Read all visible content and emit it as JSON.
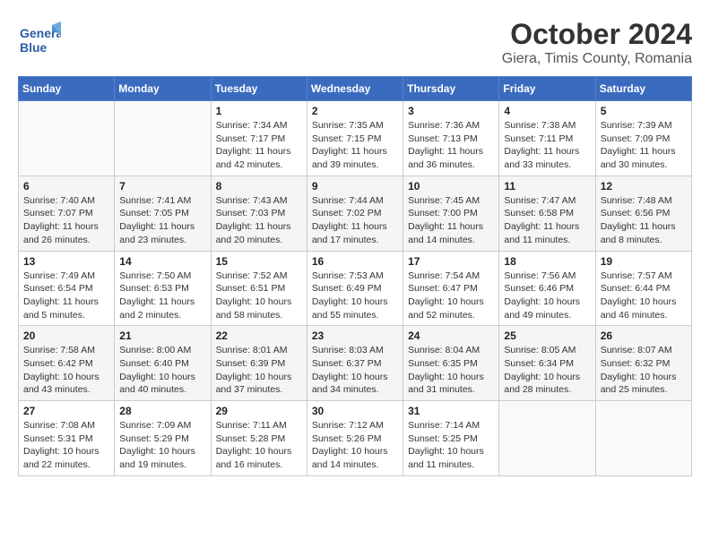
{
  "header": {
    "logo_line1": "General",
    "logo_line2": "Blue",
    "title": "October 2024",
    "subtitle": "Giera, Timis County, Romania"
  },
  "weekdays": [
    "Sunday",
    "Monday",
    "Tuesday",
    "Wednesday",
    "Thursday",
    "Friday",
    "Saturday"
  ],
  "weeks": [
    [
      {
        "day": "",
        "sunrise": "",
        "sunset": "",
        "daylight": ""
      },
      {
        "day": "",
        "sunrise": "",
        "sunset": "",
        "daylight": ""
      },
      {
        "day": "1",
        "sunrise": "Sunrise: 7:34 AM",
        "sunset": "Sunset: 7:17 PM",
        "daylight": "Daylight: 11 hours and 42 minutes."
      },
      {
        "day": "2",
        "sunrise": "Sunrise: 7:35 AM",
        "sunset": "Sunset: 7:15 PM",
        "daylight": "Daylight: 11 hours and 39 minutes."
      },
      {
        "day": "3",
        "sunrise": "Sunrise: 7:36 AM",
        "sunset": "Sunset: 7:13 PM",
        "daylight": "Daylight: 11 hours and 36 minutes."
      },
      {
        "day": "4",
        "sunrise": "Sunrise: 7:38 AM",
        "sunset": "Sunset: 7:11 PM",
        "daylight": "Daylight: 11 hours and 33 minutes."
      },
      {
        "day": "5",
        "sunrise": "Sunrise: 7:39 AM",
        "sunset": "Sunset: 7:09 PM",
        "daylight": "Daylight: 11 hours and 30 minutes."
      }
    ],
    [
      {
        "day": "6",
        "sunrise": "Sunrise: 7:40 AM",
        "sunset": "Sunset: 7:07 PM",
        "daylight": "Daylight: 11 hours and 26 minutes."
      },
      {
        "day": "7",
        "sunrise": "Sunrise: 7:41 AM",
        "sunset": "Sunset: 7:05 PM",
        "daylight": "Daylight: 11 hours and 23 minutes."
      },
      {
        "day": "8",
        "sunrise": "Sunrise: 7:43 AM",
        "sunset": "Sunset: 7:03 PM",
        "daylight": "Daylight: 11 hours and 20 minutes."
      },
      {
        "day": "9",
        "sunrise": "Sunrise: 7:44 AM",
        "sunset": "Sunset: 7:02 PM",
        "daylight": "Daylight: 11 hours and 17 minutes."
      },
      {
        "day": "10",
        "sunrise": "Sunrise: 7:45 AM",
        "sunset": "Sunset: 7:00 PM",
        "daylight": "Daylight: 11 hours and 14 minutes."
      },
      {
        "day": "11",
        "sunrise": "Sunrise: 7:47 AM",
        "sunset": "Sunset: 6:58 PM",
        "daylight": "Daylight: 11 hours and 11 minutes."
      },
      {
        "day": "12",
        "sunrise": "Sunrise: 7:48 AM",
        "sunset": "Sunset: 6:56 PM",
        "daylight": "Daylight: 11 hours and 8 minutes."
      }
    ],
    [
      {
        "day": "13",
        "sunrise": "Sunrise: 7:49 AM",
        "sunset": "Sunset: 6:54 PM",
        "daylight": "Daylight: 11 hours and 5 minutes."
      },
      {
        "day": "14",
        "sunrise": "Sunrise: 7:50 AM",
        "sunset": "Sunset: 6:53 PM",
        "daylight": "Daylight: 11 hours and 2 minutes."
      },
      {
        "day": "15",
        "sunrise": "Sunrise: 7:52 AM",
        "sunset": "Sunset: 6:51 PM",
        "daylight": "Daylight: 10 hours and 58 minutes."
      },
      {
        "day": "16",
        "sunrise": "Sunrise: 7:53 AM",
        "sunset": "Sunset: 6:49 PM",
        "daylight": "Daylight: 10 hours and 55 minutes."
      },
      {
        "day": "17",
        "sunrise": "Sunrise: 7:54 AM",
        "sunset": "Sunset: 6:47 PM",
        "daylight": "Daylight: 10 hours and 52 minutes."
      },
      {
        "day": "18",
        "sunrise": "Sunrise: 7:56 AM",
        "sunset": "Sunset: 6:46 PM",
        "daylight": "Daylight: 10 hours and 49 minutes."
      },
      {
        "day": "19",
        "sunrise": "Sunrise: 7:57 AM",
        "sunset": "Sunset: 6:44 PM",
        "daylight": "Daylight: 10 hours and 46 minutes."
      }
    ],
    [
      {
        "day": "20",
        "sunrise": "Sunrise: 7:58 AM",
        "sunset": "Sunset: 6:42 PM",
        "daylight": "Daylight: 10 hours and 43 minutes."
      },
      {
        "day": "21",
        "sunrise": "Sunrise: 8:00 AM",
        "sunset": "Sunset: 6:40 PM",
        "daylight": "Daylight: 10 hours and 40 minutes."
      },
      {
        "day": "22",
        "sunrise": "Sunrise: 8:01 AM",
        "sunset": "Sunset: 6:39 PM",
        "daylight": "Daylight: 10 hours and 37 minutes."
      },
      {
        "day": "23",
        "sunrise": "Sunrise: 8:03 AM",
        "sunset": "Sunset: 6:37 PM",
        "daylight": "Daylight: 10 hours and 34 minutes."
      },
      {
        "day": "24",
        "sunrise": "Sunrise: 8:04 AM",
        "sunset": "Sunset: 6:35 PM",
        "daylight": "Daylight: 10 hours and 31 minutes."
      },
      {
        "day": "25",
        "sunrise": "Sunrise: 8:05 AM",
        "sunset": "Sunset: 6:34 PM",
        "daylight": "Daylight: 10 hours and 28 minutes."
      },
      {
        "day": "26",
        "sunrise": "Sunrise: 8:07 AM",
        "sunset": "Sunset: 6:32 PM",
        "daylight": "Daylight: 10 hours and 25 minutes."
      }
    ],
    [
      {
        "day": "27",
        "sunrise": "Sunrise: 7:08 AM",
        "sunset": "Sunset: 5:31 PM",
        "daylight": "Daylight: 10 hours and 22 minutes."
      },
      {
        "day": "28",
        "sunrise": "Sunrise: 7:09 AM",
        "sunset": "Sunset: 5:29 PM",
        "daylight": "Daylight: 10 hours and 19 minutes."
      },
      {
        "day": "29",
        "sunrise": "Sunrise: 7:11 AM",
        "sunset": "Sunset: 5:28 PM",
        "daylight": "Daylight: 10 hours and 16 minutes."
      },
      {
        "day": "30",
        "sunrise": "Sunrise: 7:12 AM",
        "sunset": "Sunset: 5:26 PM",
        "daylight": "Daylight: 10 hours and 14 minutes."
      },
      {
        "day": "31",
        "sunrise": "Sunrise: 7:14 AM",
        "sunset": "Sunset: 5:25 PM",
        "daylight": "Daylight: 10 hours and 11 minutes."
      },
      {
        "day": "",
        "sunrise": "",
        "sunset": "",
        "daylight": ""
      },
      {
        "day": "",
        "sunrise": "",
        "sunset": "",
        "daylight": ""
      }
    ]
  ]
}
